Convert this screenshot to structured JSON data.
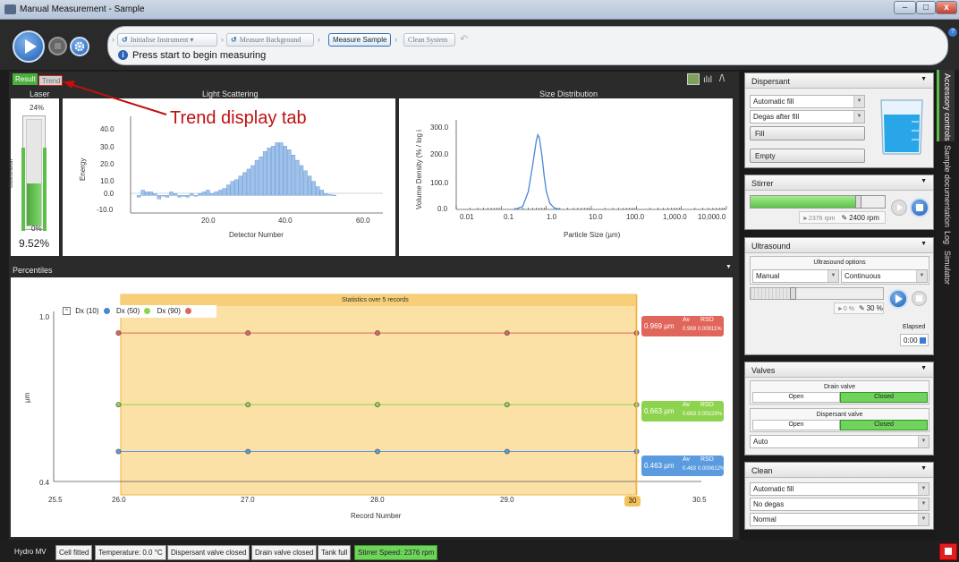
{
  "window": {
    "title": "Manual Measurement - Sample",
    "min": "–",
    "max": "□",
    "close": "x"
  },
  "workflow": {
    "steps": [
      {
        "label": "Initialise Instrument",
        "dropdown": "▾"
      },
      {
        "label": "Measure Background"
      },
      {
        "label": "Measure Sample"
      },
      {
        "label": "Clean System"
      }
    ],
    "message": "Press start to begin measuring",
    "message_icon": "i"
  },
  "tabs": {
    "result": "Result",
    "trend": "Trend"
  },
  "annotation": "Trend display tab",
  "panels": {
    "laser": "Laser",
    "light_scattering": "Light Scattering",
    "size_distribution": "Size Distribution",
    "percentiles": "Percentiles"
  },
  "laser": {
    "top": "24%",
    "bottom": "0%",
    "obscuration_label": "Obscuration",
    "value": "9.52%",
    "level": 0.4
  },
  "light_scattering": {
    "ylabel": "Energy",
    "xlabel": "Detector Number",
    "yticks": [
      "40.0",
      "30.0",
      "20.0",
      "10.0",
      "0.0",
      "-10.0"
    ],
    "xticks": [
      "20.0",
      "40.0",
      "60.0"
    ]
  },
  "size_distribution": {
    "ylabel": "Volume Density (% / log i",
    "xlabel": "Particle Size (µm)",
    "yticks": [
      "300.0",
      "200.0",
      "100.0",
      "0.0"
    ],
    "xticks": [
      "0.01",
      "0.1",
      "1.0",
      "10.0",
      "100.0",
      "1,000.0",
      "10,000.0"
    ]
  },
  "percentiles": {
    "stats_title": "Statistics over 5 records",
    "legend": [
      {
        "label": "Dx (10)",
        "color": "#4a86d6"
      },
      {
        "label": "Dx (50)",
        "color": "#8ed34e"
      },
      {
        "label": "Dx (90)",
        "color": "#e0655a"
      }
    ],
    "ylabel": "µm",
    "yticks": [
      "1.0",
      "0.4"
    ],
    "xlabel": "Record Number",
    "xticks": [
      "25.5",
      "26.0",
      "27.0",
      "28.0",
      "29.0",
      "30.5"
    ],
    "marker": "30",
    "badges": [
      {
        "value": "0.969 µm",
        "av": "Av",
        "rsd": "RSD",
        "av_val": "0.969",
        "rsd_val": "0.00911%",
        "color": "#e0655a"
      },
      {
        "value": "0.663 µm",
        "av": "Av",
        "rsd": "RSD",
        "av_val": "0.663",
        "rsd_val": "0.00229%",
        "color": "#8ed34e"
      },
      {
        "value": "0.463 µm",
        "av": "Av",
        "rsd": "RSD",
        "av_val": "0.463",
        "rsd_val": "0.000612%",
        "color": "#5a9be0"
      }
    ]
  },
  "chart_data": [
    {
      "type": "bar",
      "title": "Light Scattering",
      "xlabel": "Detector Number",
      "ylabel": "Energy",
      "xlim": [
        1,
        63
      ],
      "ylim": [
        -10,
        45
      ],
      "x": [
        3,
        4,
        5,
        6,
        7,
        8,
        9,
        10,
        11,
        12,
        13,
        14,
        15,
        16,
        17,
        18,
        19,
        20,
        21,
        22,
        23,
        24,
        25,
        26,
        27,
        28,
        29,
        30,
        31,
        32,
        33,
        34,
        35,
        36,
        37,
        38,
        39,
        40,
        41,
        42,
        43,
        44,
        45,
        46,
        47,
        48,
        49,
        50,
        51
      ],
      "values": [
        -1,
        3,
        2,
        2,
        1,
        -2,
        0,
        -1,
        2,
        1,
        -1,
        0,
        -1,
        1,
        0,
        1,
        2,
        3,
        1,
        2,
        3,
        4,
        6,
        8,
        9,
        11,
        13,
        15,
        17,
        20,
        22,
        25,
        27,
        28,
        30,
        30,
        28,
        26,
        23,
        20,
        17,
        14,
        11,
        8,
        5,
        3,
        1,
        0.5,
        0.2
      ]
    },
    {
      "type": "line",
      "title": "Size Distribution",
      "xlabel": "Particle Size (µm)",
      "ylabel": "Volume Density (% / log i",
      "x_scale": "log",
      "xlim": [
        0.01,
        10000
      ],
      "ylim": [
        0,
        300
      ],
      "x": [
        0.2,
        0.3,
        0.4,
        0.5,
        0.6,
        0.65,
        0.7,
        0.8,
        0.9,
        1.0,
        1.2,
        1.5,
        2.0
      ],
      "y": [
        0,
        10,
        60,
        150,
        230,
        250,
        240,
        180,
        110,
        60,
        20,
        5,
        0
      ]
    },
    {
      "type": "line",
      "title": "Percentiles",
      "xlabel": "Record Number",
      "ylabel": "µm",
      "xlim": [
        25.5,
        30.5
      ],
      "ylim": [
        0.4,
        1.0
      ],
      "x": [
        26,
        27,
        28,
        29,
        30
      ],
      "series": [
        {
          "name": "Dx (10)",
          "values": [
            0.463,
            0.463,
            0.463,
            0.463,
            0.463
          ],
          "color": "#5a9be0"
        },
        {
          "name": "Dx (50)",
          "values": [
            0.663,
            0.663,
            0.663,
            0.663,
            0.663
          ],
          "color": "#8ed34e"
        },
        {
          "name": "Dx (90)",
          "values": [
            0.969,
            0.969,
            0.969,
            0.969,
            0.969
          ],
          "color": "#e0655a"
        }
      ]
    }
  ],
  "dispersant": {
    "title": "Dispersant",
    "fill_mode": "Automatic fill",
    "degas": "Degas after fill",
    "fill_button": "Fill",
    "empty_button": "Empty"
  },
  "stirrer": {
    "title": "Stirrer",
    "actual": "►2376 rpm",
    "setpoint": "2400 rpm",
    "level": 0.8
  },
  "ultrasound": {
    "title": "Ultrasound",
    "options_label": "Ultrasound options",
    "mode": "Manual",
    "continuous": "Continuous",
    "actual": "►0 %",
    "setpoint": "30 %",
    "elapsed_label": "Elapsed",
    "elapsed": "0:00"
  },
  "valves": {
    "title": "Valves",
    "drain_label": "Drain valve",
    "dispersant_label": "Dispersant valve",
    "open": "Open",
    "closed": "Closed",
    "mode": "Auto"
  },
  "clean": {
    "title": "Clean",
    "fill": "Automatic fill",
    "degas": "No degas",
    "mode": "Normal"
  },
  "side_tabs": [
    "Accessory controls",
    "Sample documentation",
    "Log",
    "Simulator"
  ],
  "statusbar": {
    "instrument": "Hydro MV",
    "items": [
      "Cell fitted",
      "Temperature: 0.0 °C",
      "Dispersant valve closed",
      "Drain valve closed",
      "Tank full",
      "Stirrer Speed: 2376 rpm"
    ]
  },
  "colors": {
    "accent_green": "#6fd45b",
    "stats_fill": "#fbe1a6",
    "stats_border": "#f0b445"
  }
}
